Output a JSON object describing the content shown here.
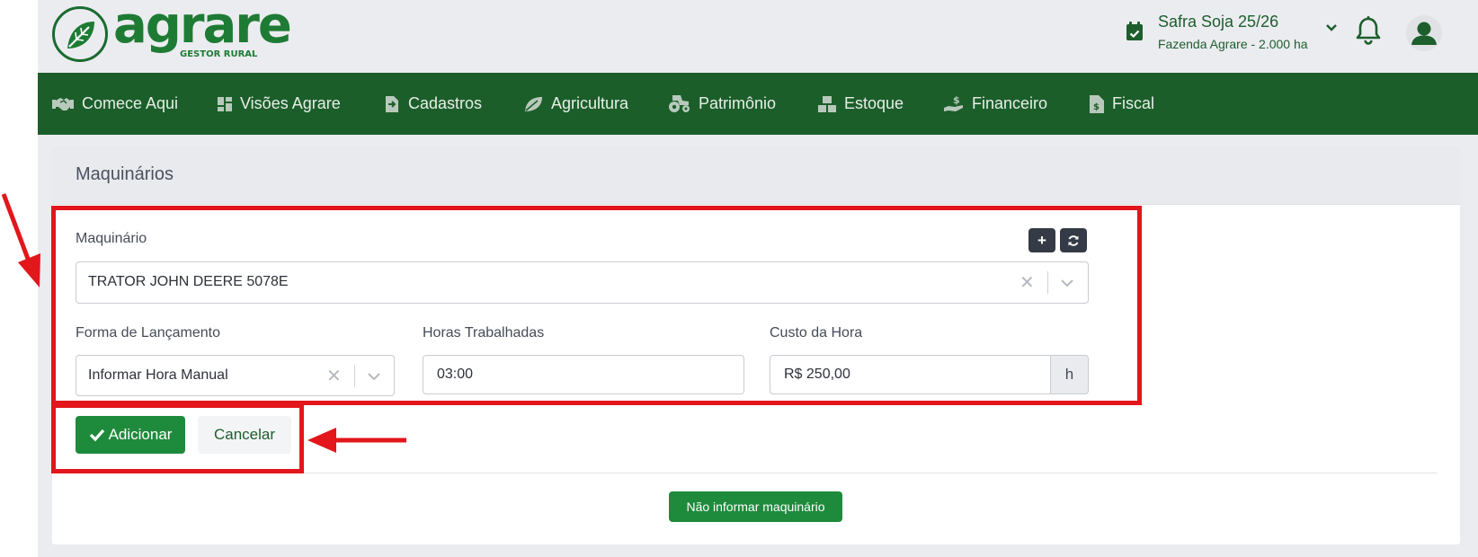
{
  "brand": {
    "name": "agrare",
    "tagline": "GESTOR RURAL"
  },
  "season": {
    "title": "Safra Soja 25/26",
    "farm": "Fazenda Agrare - 2.000 ha"
  },
  "nav": [
    {
      "label": "Comece Aqui"
    },
    {
      "label": "Visões Agrare"
    },
    {
      "label": "Cadastros"
    },
    {
      "label": "Agricultura"
    },
    {
      "label": "Patrimônio"
    },
    {
      "label": "Estoque"
    },
    {
      "label": "Financeiro"
    },
    {
      "label": "Fiscal"
    }
  ],
  "card": {
    "title": "Maquinários"
  },
  "form": {
    "machine": {
      "label": "Maquinário",
      "value": "TRATOR JOHN DEERE 5078E"
    },
    "launch_mode": {
      "label": "Forma de Lançamento",
      "value": "Informar Hora Manual"
    },
    "hours": {
      "label": "Horas Trabalhadas",
      "value": "03:00"
    },
    "hour_cost": {
      "label": "Custo da Hora",
      "value": "R$ 250,00",
      "addon": "h"
    }
  },
  "actions": {
    "add_label": "Adicionar",
    "cancel_label": "Cancelar",
    "skip_label": "Não informar maquinário",
    "plus_label": "+"
  },
  "colors": {
    "brand_green": "#1e7b34",
    "nav_bg": "#1c5e2a",
    "button_green": "#1e8a3c",
    "annotation_red": "#e2161b"
  },
  "icons": {
    "season": "calendar-check-icon",
    "notifications": "bell-icon",
    "user": "user-icon",
    "refresh": "refresh-icon"
  }
}
